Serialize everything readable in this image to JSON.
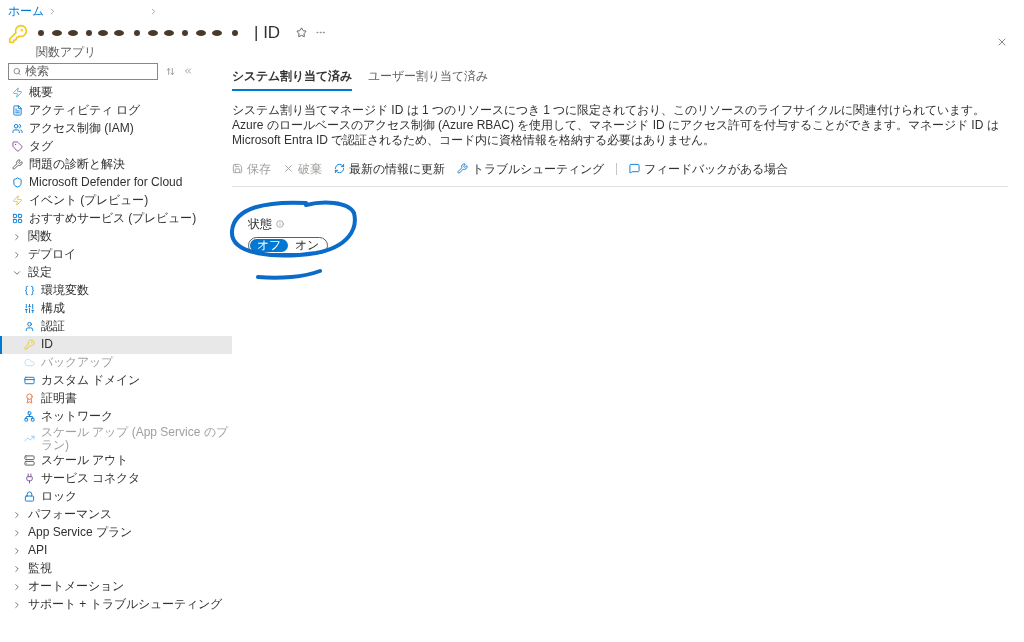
{
  "breadcrumb": [
    {
      "label": "ホーム"
    }
  ],
  "header": {
    "title": "| ID",
    "subtitle": "関数アプリ"
  },
  "sidebar": {
    "search": {
      "placeholder": "検索"
    },
    "items": [
      {
        "kind": "link",
        "label": "概要",
        "selected": false,
        "disabled": false
      },
      {
        "kind": "link",
        "label": "アクティビティ ログ",
        "selected": false,
        "disabled": false
      },
      {
        "kind": "link",
        "label": "アクセス制御 (IAM)",
        "selected": false,
        "disabled": false
      },
      {
        "kind": "link",
        "label": "タグ",
        "selected": false,
        "disabled": false
      },
      {
        "kind": "link",
        "label": "問題の診断と解決",
        "selected": false,
        "disabled": false
      },
      {
        "kind": "link",
        "label": "Microsoft Defender for Cloud",
        "selected": false,
        "disabled": false
      },
      {
        "kind": "link",
        "label": "イベント (プレビュー)",
        "selected": false,
        "disabled": false
      },
      {
        "kind": "link",
        "label": "おすすめサービス (プレビュー)",
        "selected": false,
        "disabled": false
      },
      {
        "kind": "group",
        "label": "関数",
        "expanded": false
      },
      {
        "kind": "group",
        "label": "デプロイ",
        "expanded": false
      },
      {
        "kind": "group",
        "label": "設定",
        "expanded": true,
        "children": [
          {
            "kind": "link",
            "label": "環境変数",
            "selected": false,
            "disabled": false
          },
          {
            "kind": "link",
            "label": "構成",
            "selected": false,
            "disabled": false
          },
          {
            "kind": "link",
            "label": "認証",
            "selected": false,
            "disabled": false
          },
          {
            "kind": "link",
            "label": "ID",
            "selected": true,
            "disabled": false
          },
          {
            "kind": "link",
            "label": "バックアップ",
            "selected": false,
            "disabled": true
          },
          {
            "kind": "link",
            "label": "カスタム ドメイン",
            "selected": false,
            "disabled": false
          },
          {
            "kind": "link",
            "label": "証明書",
            "selected": false,
            "disabled": false
          },
          {
            "kind": "link",
            "label": "ネットワーク",
            "selected": false,
            "disabled": false
          },
          {
            "kind": "link",
            "label": "スケール アップ (App Service のプラン)",
            "selected": false,
            "disabled": true
          },
          {
            "kind": "link",
            "label": "スケール アウト",
            "selected": false,
            "disabled": false
          },
          {
            "kind": "link",
            "label": "サービス コネクタ",
            "selected": false,
            "disabled": false
          },
          {
            "kind": "link",
            "label": "ロック",
            "selected": false,
            "disabled": false
          }
        ]
      },
      {
        "kind": "group",
        "label": "パフォーマンス",
        "expanded": false
      },
      {
        "kind": "group",
        "label": "App Service プラン",
        "expanded": false
      },
      {
        "kind": "group",
        "label": "API",
        "expanded": false
      },
      {
        "kind": "group",
        "label": "監視",
        "expanded": false
      },
      {
        "kind": "group",
        "label": "オートメーション",
        "expanded": false
      },
      {
        "kind": "group",
        "label": "サポート + トラブルシューティング",
        "expanded": false
      }
    ]
  },
  "tabs": [
    {
      "label": "システム割り当て済み",
      "selected": true
    },
    {
      "label": "ユーザー割り当て済み",
      "selected": false
    }
  ],
  "description": "システム割り当てマネージド ID は 1 つのリソースにつき 1 つに限定されており、このリソースのライフサイクルに関連付けられています。Azure のロールベースのアクセス制御 (Azure RBAC) を使用して、マネージド ID にアクセス許可を付与することができます。マネージド ID は Microsoft Entra ID で認証されるため、コード内に資格情報を格納する必要はありません。",
  "toolbar": [
    {
      "label": "保存",
      "disabled": true
    },
    {
      "label": "破棄",
      "disabled": true
    },
    {
      "label": "最新の情報に更新",
      "disabled": false
    },
    {
      "label": "トラブルシューティング",
      "disabled": false
    },
    {
      "label": "フィードバックがある場合",
      "disabled": false
    }
  ],
  "status": {
    "label": "状態",
    "options": [
      {
        "label": "オフ",
        "selected": true
      },
      {
        "label": "オン",
        "selected": false
      }
    ]
  }
}
